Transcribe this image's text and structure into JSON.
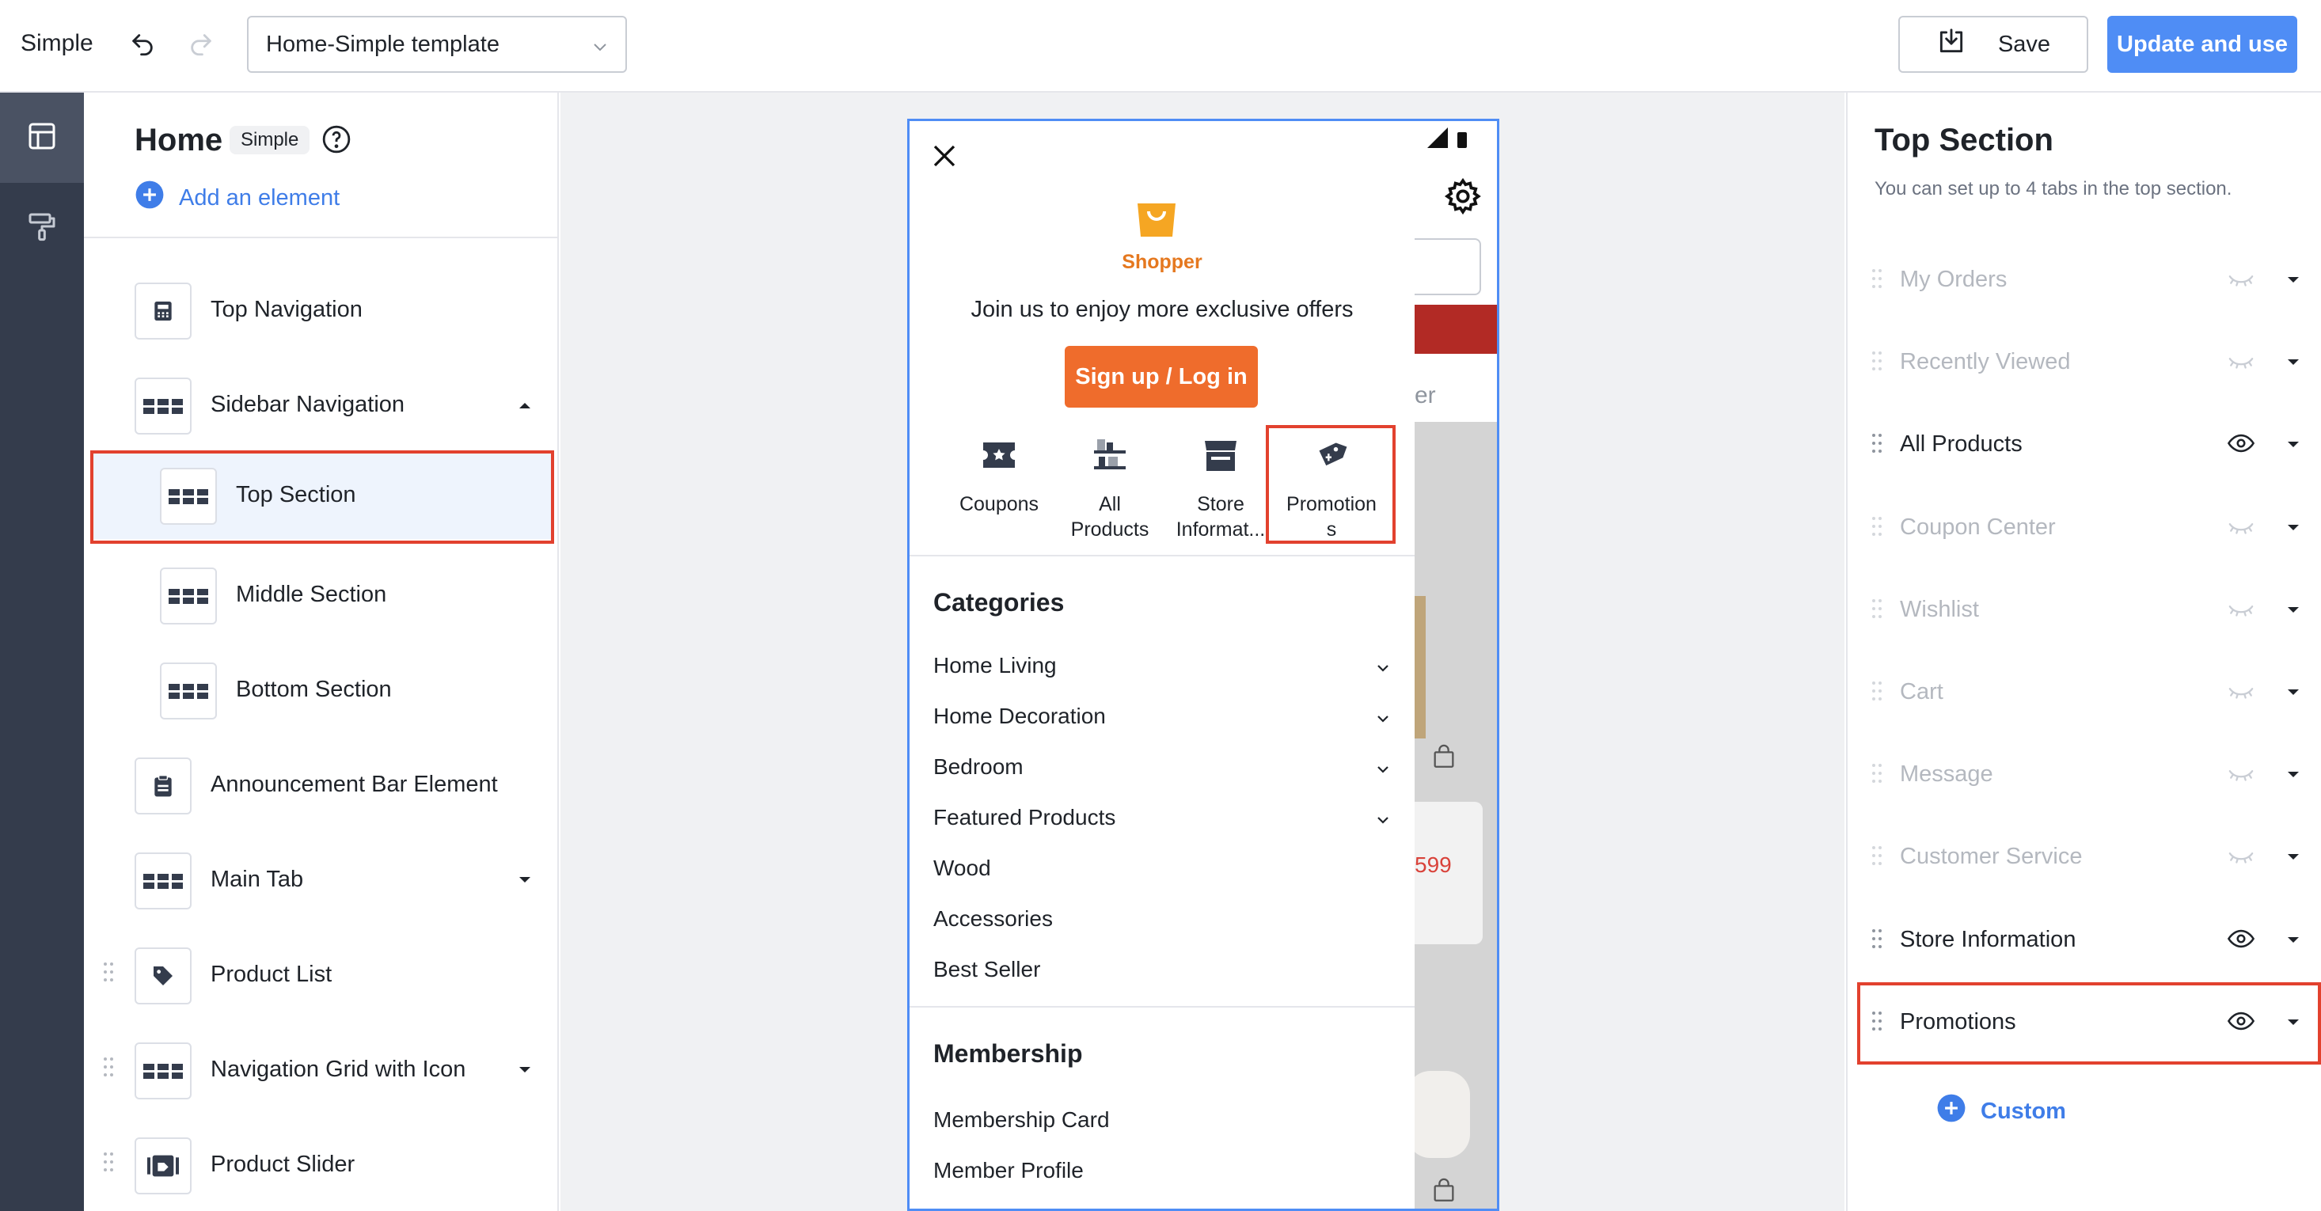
{
  "topbar": {
    "app_name": "Simple",
    "template_select": "Home-Simple template",
    "save_label": "Save",
    "update_label": "Update and use"
  },
  "left_panel": {
    "title": "Home",
    "badge": "Simple",
    "add_element": "Add an element",
    "items": [
      {
        "label": "Top Navigation",
        "icon": "calculator-icon"
      },
      {
        "label": "Sidebar Navigation",
        "icon": "grid-icon",
        "expanded": true
      },
      {
        "label": "Top Section",
        "icon": "grid-icon",
        "selected": true
      },
      {
        "label": "Middle Section",
        "icon": "grid-icon"
      },
      {
        "label": "Bottom Section",
        "icon": "grid-icon"
      },
      {
        "label": "Announcement Bar Element",
        "icon": "clipboard-icon"
      },
      {
        "label": "Main Tab",
        "icon": "grid-icon"
      },
      {
        "label": "Product List",
        "icon": "tag-icon"
      },
      {
        "label": "Navigation Grid with Icon",
        "icon": "grid-icon"
      },
      {
        "label": "Product Slider",
        "icon": "slider-icon"
      }
    ]
  },
  "phone": {
    "shop_name": "Shopper",
    "join_text": "Join us to enjoy more exclusive offers",
    "signup_label": "Sign up / Log in",
    "quick_links": [
      {
        "label": "Coupons",
        "icon": "coupon-icon"
      },
      {
        "label": "All\nProducts",
        "icon": "shelf-icon"
      },
      {
        "label": "Store\nInformat...",
        "icon": "store-icon"
      },
      {
        "label": "Promotion\ns",
        "icon": "promotion-tag-icon"
      }
    ],
    "categories_title": "Categories",
    "categories": [
      {
        "label": "Home Living",
        "expandable": true
      },
      {
        "label": "Home Decoration",
        "expandable": true
      },
      {
        "label": "Bedroom",
        "expandable": true
      },
      {
        "label": "Featured Products",
        "expandable": true
      },
      {
        "label": "Wood",
        "expandable": false
      },
      {
        "label": "Accessories",
        "expandable": false
      },
      {
        "label": "Best Seller",
        "expandable": false
      }
    ],
    "membership_title": "Membership",
    "membership": [
      "Membership Card",
      "Member Profile"
    ],
    "background_fragments": {
      "text_er": "er",
      "price": "599"
    }
  },
  "right_panel": {
    "title": "Top Section",
    "subtitle": "You can set up to 4 tabs in the top section.",
    "tabs": [
      {
        "label": "My Orders",
        "visible": false
      },
      {
        "label": "Recently Viewed",
        "visible": false
      },
      {
        "label": "All Products",
        "visible": true
      },
      {
        "label": "Coupon Center",
        "visible": false
      },
      {
        "label": "Wishlist",
        "visible": false
      },
      {
        "label": "Cart",
        "visible": false
      },
      {
        "label": "Message",
        "visible": false
      },
      {
        "label": "Customer Service",
        "visible": false
      },
      {
        "label": "Store Information",
        "visible": true
      },
      {
        "label": "Promotions",
        "visible": true
      }
    ],
    "custom_label": "Custom"
  },
  "colors": {
    "accent": "#4f8df5",
    "link": "#3f7de8",
    "highlight": "#e2412e",
    "signup": "#ef6c2c",
    "brand": "#e5781f",
    "rail": "#343c4c"
  }
}
